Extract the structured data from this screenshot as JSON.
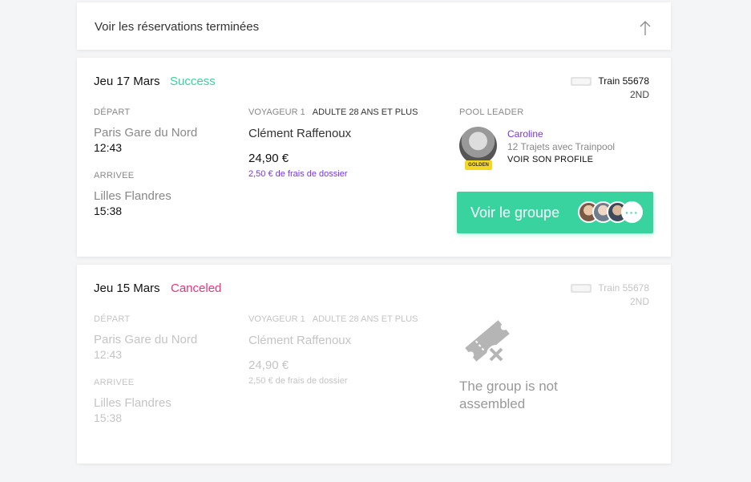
{
  "top_bar": {
    "label": "Voir les réservations terminées"
  },
  "bookings": [
    {
      "date": "Jeu 17 Mars",
      "status": "Success",
      "status_color": "#38d39f",
      "train": "Train 55678",
      "class": "2ND",
      "departure_label": "DÉPART",
      "departure_station": "Paris Gare du Nord",
      "departure_time": "12:43",
      "arrival_label": "ARRIVEE",
      "arrival_station": "Lilles Flandres",
      "arrival_time": "15:38",
      "voyageur_label": "VOYAGEUR 1",
      "voyageur_category": "ADULTE 28 ANS ET PLUS",
      "voyageur_name": "Clément Raffenoux",
      "price": "24,90 €",
      "fees": "2,50 € de frais de dossier",
      "pool_leader_label": "POOL LEADER",
      "leader_name": "Caroline",
      "leader_trips": "12 Trajets avec Trainpool",
      "leader_link": "VOIR SON PROFILE",
      "leader_badge": "GOLDEN",
      "group_button": "Voir le groupe",
      "more_avatars": "···"
    },
    {
      "date": "Jeu 15 Mars",
      "status": "Canceled",
      "status_color": "#f0327c",
      "train": "Train 55678",
      "class": "2ND",
      "departure_label": "DÉPART",
      "departure_station": "Paris Gare du Nord",
      "departure_time": "12:43",
      "arrival_label": "ARRIVEE",
      "arrival_station": "Lilles Flandres",
      "arrival_time": "15:38",
      "voyageur_label": "VOYAGEUR 1",
      "voyageur_category": "ADULTE 28 ANS ET PLUS",
      "voyageur_name": "Clément Raffenoux",
      "price": "24,90 €",
      "fees": "2,50 € de frais de dossier",
      "not_assembled": "The group is not assembled",
      "icon": "ticket-cancel-icon"
    }
  ],
  "colors": {
    "accent": "#38d39f",
    "purple": "#7a34e6",
    "canceled": "#f0327c"
  }
}
